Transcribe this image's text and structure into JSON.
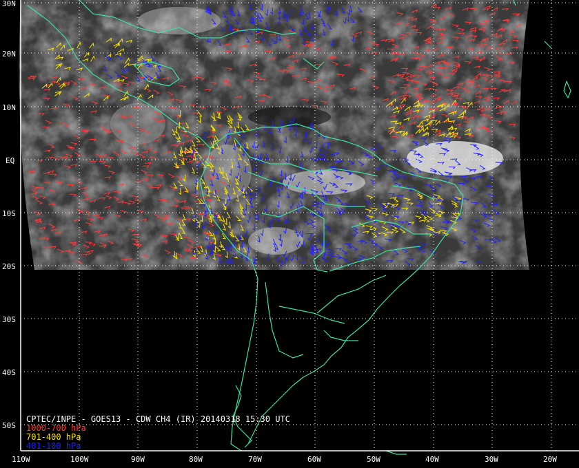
{
  "title": "CPTEC/INPE - GOES13 - CDW CH4 (IR) 20140318 15:30 UTC",
  "legend": [
    {
      "label": "1000-700 hPa",
      "color": "#ff3b3b"
    },
    {
      "label": "701-400 hPa",
      "color": "#ffe600"
    },
    {
      "label": "401-100 hPa",
      "color": "#2020ff"
    }
  ],
  "lat_labels": [
    "30N",
    "20N",
    "10N",
    "EQ",
    "10S",
    "20S",
    "30S",
    "40S",
    "50S"
  ],
  "lon_labels": [
    "110W",
    "100W",
    "90W",
    "80W",
    "70W",
    "60W",
    "50W",
    "40W",
    "30W",
    "20W"
  ],
  "colors": {
    "coastline": "#3fe0a0",
    "grid": "#ffffff",
    "frame": "#ffffff",
    "imagery_dark": "#3a3a3a",
    "imagery_light": "#8a8a8a"
  }
}
